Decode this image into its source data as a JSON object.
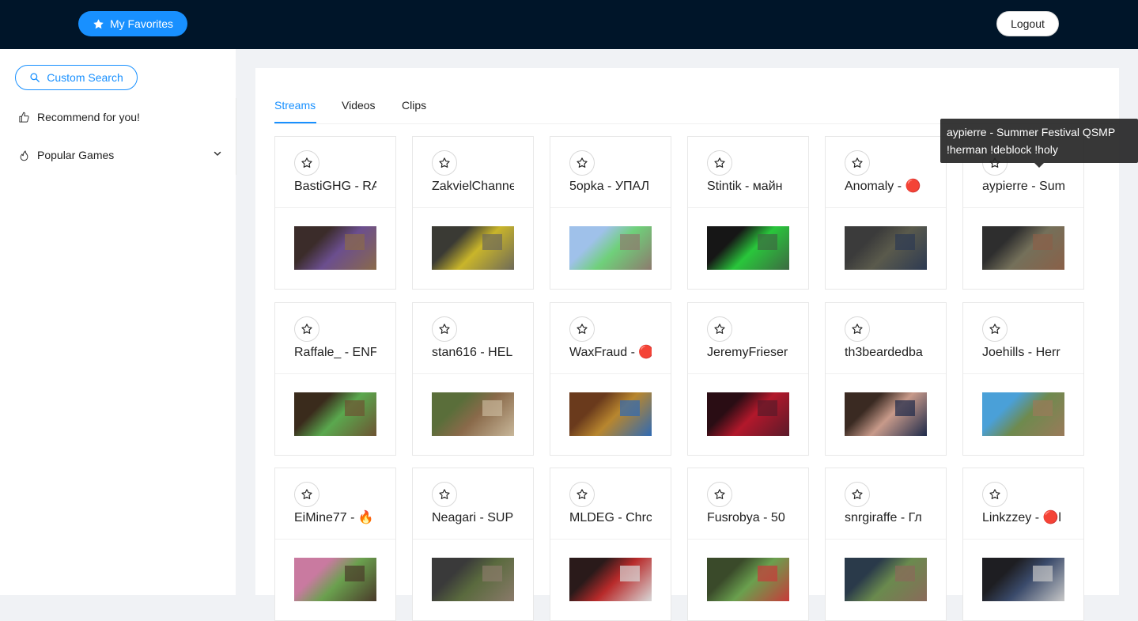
{
  "header": {
    "favorites_label": "My Favorites",
    "logout_label": "Logout",
    "background": "#001529",
    "accent": "#1890ff"
  },
  "sidebar": {
    "search_label": "Custom Search",
    "items": [
      {
        "label": "Recommend for you!",
        "icon": "thumbs-up-icon"
      },
      {
        "label": "Popular Games",
        "icon": "fire-icon",
        "expand_icon": "chevron-down-icon"
      }
    ]
  },
  "tabs": [
    {
      "label": "Streams",
      "active": true
    },
    {
      "label": "Videos",
      "active": false
    },
    {
      "label": "Clips",
      "active": false
    }
  ],
  "streams": [
    {
      "title": "BastiGHG - RA",
      "thumb": [
        "#3b2c2a",
        "#6b4e8e",
        "#8a6a4a"
      ]
    },
    {
      "title": "ZakvielChanne",
      "thumb": [
        "#3a3a34",
        "#c9b52a",
        "#6e6a58"
      ]
    },
    {
      "title": "5opka - УПАЛ",
      "thumb": [
        "#9fc1ea",
        "#6fd07a",
        "#8d7a6e"
      ]
    },
    {
      "title": "Stintik - майн",
      "thumb": [
        "#161616",
        "#29c63b",
        "#3d6a42"
      ]
    },
    {
      "title": "Anomaly - 🔴",
      "thumb": [
        "#3b3b3b",
        "#5a5a4c",
        "#2d3a52"
      ]
    },
    {
      "title": "aypierre - Sum",
      "thumb": [
        "#2e2e2e",
        "#74705a",
        "#8a6048"
      ]
    },
    {
      "title": "Raffale_ - ENF",
      "thumb": [
        "#3a2b1c",
        "#5aa84e",
        "#6d5332"
      ]
    },
    {
      "title": "stan616 - HEL",
      "thumb": [
        "#5a6e3a",
        "#8a6a4a",
        "#c8b79a"
      ]
    },
    {
      "title": "WaxFraud - 🔴",
      "thumb": [
        "#6a3a1c",
        "#b8862e",
        "#2f6ab4"
      ]
    },
    {
      "title": "JeremyFrieser",
      "thumb": [
        "#2a0d14",
        "#b2182b",
        "#5a1a2a"
      ]
    },
    {
      "title": "th3beardedba",
      "thumb": [
        "#3a2a22",
        "#c89a8a",
        "#1e2a4a"
      ]
    },
    {
      "title": "Joehills - Herr",
      "thumb": [
        "#4aa0d8",
        "#6e8a4e",
        "#9a7a5a"
      ]
    },
    {
      "title": "EiMine77 - 🔥",
      "thumb": [
        "#c97aa0",
        "#6aa04e",
        "#4a3a2a"
      ]
    },
    {
      "title": "Neagari - SUP",
      "thumb": [
        "#3a3a3a",
        "#5a6a3e",
        "#8a7a6a"
      ]
    },
    {
      "title": "MLDEG - Chrc",
      "thumb": [
        "#2a1a1a",
        "#b82a2a",
        "#d8d8d8"
      ]
    },
    {
      "title": "Fusrobya - 50",
      "thumb": [
        "#3a4a2a",
        "#6aa04e",
        "#c83a3a"
      ]
    },
    {
      "title": "snrgiraffe - Гл",
      "thumb": [
        "#2a3a4a",
        "#6a8a4e",
        "#8a6a5a"
      ]
    },
    {
      "title": "Linkzzey - 🔴l",
      "thumb": [
        "#1e1e22",
        "#3a4a6a",
        "#c8c8c8"
      ]
    }
  ],
  "tooltip": {
    "line1": "aypierre - Summer Festival QSMP",
    "line2": "!herman !deblock !holy"
  }
}
